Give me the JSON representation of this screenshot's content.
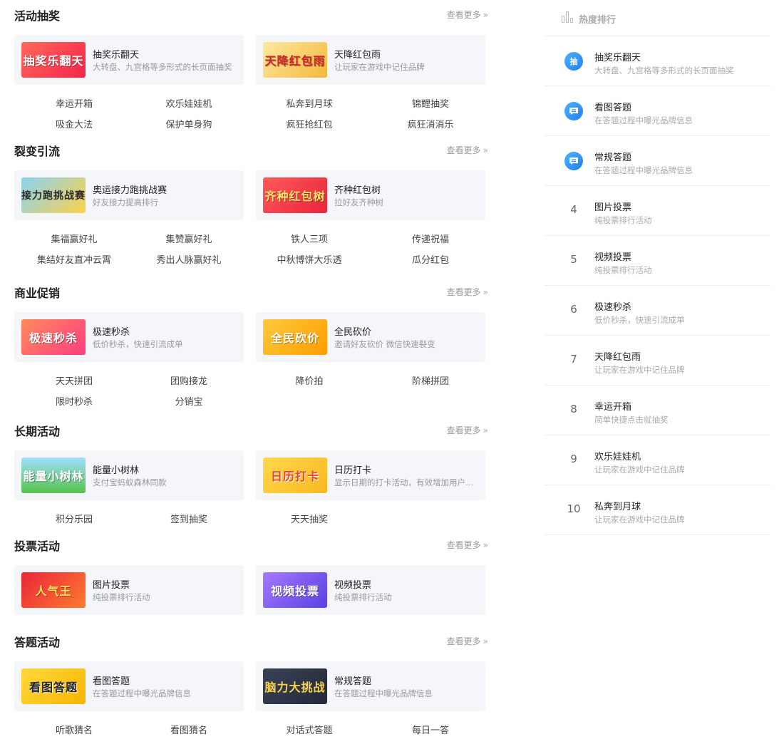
{
  "more_label": "查看更多",
  "sections": [
    {
      "title": "活动抽奖",
      "cards": [
        {
          "thumb": "抽奖乐翻天",
          "title": "抽奖乐翻天",
          "desc": "大转盘、九宫格等多形式的长页面抽奖"
        },
        {
          "thumb": "天降红包雨",
          "title": "天降红包雨",
          "desc": "让玩家在游戏中记住品牌"
        }
      ],
      "links": [
        "幸运开箱",
        "欢乐娃娃机",
        "私奔到月球",
        "锦鲤抽奖",
        "吸金大法",
        "保护单身狗",
        "疯狂抢红包",
        "疯狂消消乐"
      ]
    },
    {
      "title": "裂变引流",
      "cards": [
        {
          "thumb": "接力跑挑战赛",
          "title": "奥运接力跑挑战赛",
          "desc": "好友接力提高排行"
        },
        {
          "thumb": "齐种红包树",
          "title": "齐种红包树",
          "desc": "拉好友齐种树"
        }
      ],
      "links": [
        "集福赢好礼",
        "集赞赢好礼",
        "铁人三项",
        "传递祝福",
        "集结好友直冲云霄",
        "秀出人脉赢好礼",
        "中秋博饼大乐透",
        "瓜分红包"
      ]
    },
    {
      "title": "商业促销",
      "cards": [
        {
          "thumb": "极速秒杀",
          "title": "极速秒杀",
          "desc": "低价秒杀，快速引流成单"
        },
        {
          "thumb": "全民砍价",
          "title": "全民砍价",
          "desc": "邀请好友砍价 微信快速裂变"
        }
      ],
      "links": [
        "天天拼团",
        "团购接龙",
        "降价拍",
        "阶梯拼团",
        "限时秒杀",
        "分销宝"
      ]
    },
    {
      "title": "长期活动",
      "cards": [
        {
          "thumb": "能量小树林",
          "title": "能量小树林",
          "desc": "支付宝蚂蚁森林同款"
        },
        {
          "thumb": "日历打卡",
          "title": "日历打卡",
          "desc": "显示日期的打卡活动，有效增加用户粘性"
        }
      ],
      "links": [
        "积分乐园",
        "签到抽奖",
        "天天抽奖"
      ]
    },
    {
      "title": "投票活动",
      "cards": [
        {
          "thumb": "人气王",
          "title": "图片投票",
          "desc": "纯投票排行活动"
        },
        {
          "thumb": "视频投票",
          "title": "视频投票",
          "desc": "纯投票排行活动"
        }
      ],
      "links": []
    },
    {
      "title": "答题活动",
      "cards": [
        {
          "thumb": "看图答题",
          "title": "看图答题",
          "desc": "在答题过程中曝光品牌信息"
        },
        {
          "thumb": "脑力大挑战",
          "title": "常规答题",
          "desc": "在答题过程中曝光品牌信息"
        }
      ],
      "links": [
        "听歌猜名",
        "看图猜名",
        "对话式答题",
        "每日一答"
      ]
    }
  ],
  "ranking": {
    "title": "热度排行",
    "items": [
      {
        "badge": "抽",
        "title": "抽奖乐翻天",
        "desc": "大转盘、九宫格等多形式的长页面抽奖"
      },
      {
        "badge": "",
        "title": "看图答题",
        "desc": "在答题过程中曝光品牌信息"
      },
      {
        "badge": "",
        "title": "常规答题",
        "desc": "在答题过程中曝光品牌信息"
      },
      {
        "num": "4",
        "title": "图片投票",
        "desc": "纯投票排行活动"
      },
      {
        "num": "5",
        "title": "视频投票",
        "desc": "纯投票排行活动"
      },
      {
        "num": "6",
        "title": "极速秒杀",
        "desc": "低价秒杀，快速引流成单"
      },
      {
        "num": "7",
        "title": "天降红包雨",
        "desc": "让玩家在游戏中记住品牌"
      },
      {
        "num": "8",
        "title": "幸运开箱",
        "desc": "简单快捷点击就抽奖"
      },
      {
        "num": "9",
        "title": "欢乐娃娃机",
        "desc": "让玩家在游戏中记住品牌"
      },
      {
        "num": "10",
        "title": "私奔到月球",
        "desc": "让玩家在游戏中记住品牌"
      }
    ]
  },
  "thumb_colors": [
    "#f5414a",
    "#f3c646",
    "#fbc02d",
    "#f44336",
    "#ff6f91",
    "#ffb300",
    "#43a047",
    "#f9c623",
    "#e53935",
    "#7c5cf2",
    "#f9c623",
    "#333b4d"
  ]
}
